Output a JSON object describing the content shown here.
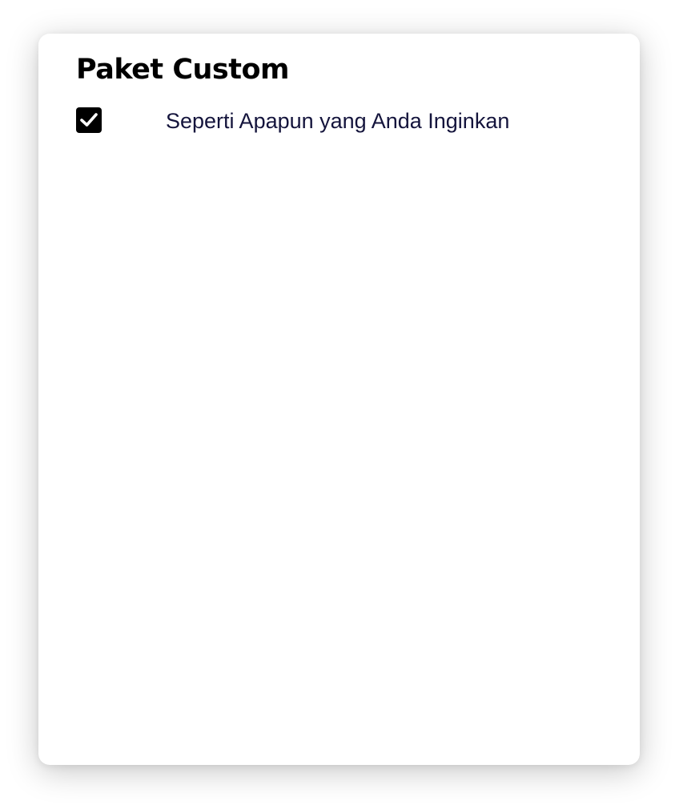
{
  "card": {
    "title": "Paket Custom",
    "features": [
      {
        "label": "Seperti Apapun yang Anda Inginkan",
        "checked": true
      }
    ]
  },
  "colors": {
    "title": "#000000",
    "feature_text": "#14143c",
    "checkbox": "#000000",
    "card_background": "#ffffff"
  },
  "icons": {
    "checkbox": "check-icon"
  }
}
